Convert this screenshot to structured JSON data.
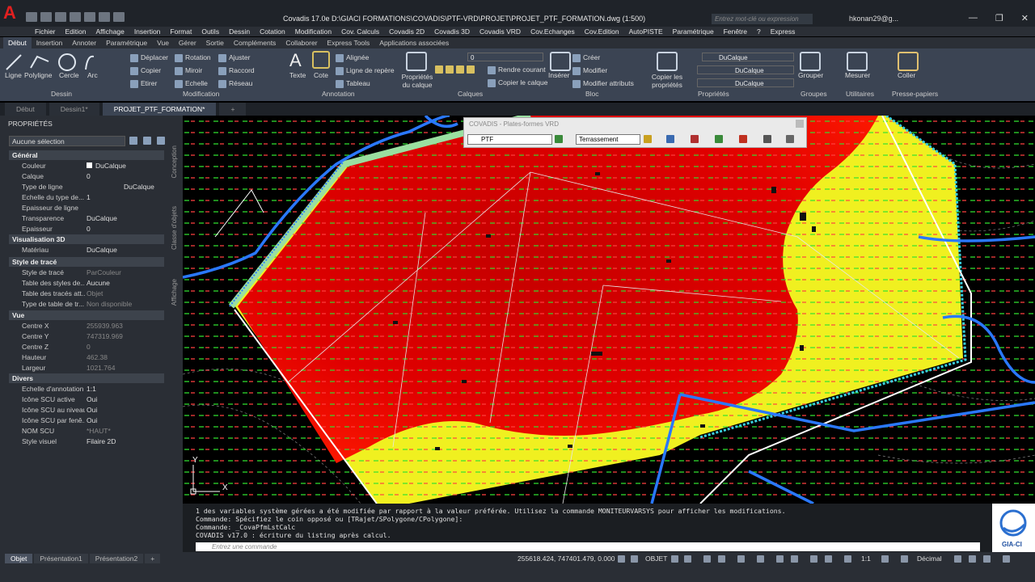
{
  "window": {
    "title": "Covadis 17.0e   D:\\GIACI FORMATIONS\\COVADIS\\PTF-VRD\\PROJET\\PROJET_PTF_FORMATION.dwg (1:500)",
    "search_placeholder": "Entrez mot-clé ou expression",
    "user": "hkonan29@g...",
    "controls": [
      "—",
      "❐",
      "✕"
    ]
  },
  "menu": [
    "Fichier",
    "Edition",
    "Affichage",
    "Insertion",
    "Format",
    "Outils",
    "Dessin",
    "Cotation",
    "Modification",
    "Cov. Calculs",
    "Covadis 2D",
    "Covadis 3D",
    "Covadis VRD",
    "Cov.Echanges",
    "Cov.Edition",
    "AutoPISTE",
    "Paramétrique",
    "Fenêtre",
    "?",
    "Express"
  ],
  "ribbon_tabs": [
    "Début",
    "Insertion",
    "Annoter",
    "Paramétrique",
    "Vue",
    "Gérer",
    "Sortie",
    "Compléments",
    "Collaborer",
    "Express Tools",
    "Applications associées"
  ],
  "ribbon": {
    "dessin": {
      "title": "Dessin",
      "tools": [
        "Ligne",
        "Polyligne",
        "Cercle",
        "Arc"
      ]
    },
    "modification": {
      "title": "Modification",
      "col1": [
        "Déplacer",
        "Copier",
        "Etirer"
      ],
      "col2": [
        "Rotation",
        "Miroir",
        "Echelle"
      ],
      "col3": [
        "Ajuster",
        "Raccord",
        "Réseau"
      ]
    },
    "annotation": {
      "title": "Annotation",
      "tools": [
        "Texte",
        "Cote"
      ],
      "list": [
        "Alignée",
        "Ligne de repère",
        "Tableau"
      ]
    },
    "calques": {
      "title": "Calques",
      "big": "Propriétés du calque",
      "layer": "0",
      "list": [
        "Rendre courant",
        "Copier le calque"
      ]
    },
    "bloc": {
      "title": "Bloc",
      "big": "Insérer",
      "list": [
        "Créer",
        "Modifier",
        "Modifier attributs"
      ]
    },
    "proprietes": {
      "title": "Propriétés",
      "big": "Copier les propriétés",
      "values": [
        "DuCalque",
        "DuCalque",
        "DuCalque"
      ]
    },
    "groupes": {
      "title": "Groupes",
      "big": "Grouper"
    },
    "utilitaires": {
      "title": "Utilitaires",
      "big": "Mesurer"
    },
    "presse": {
      "title": "Presse-papiers",
      "big": "Coller"
    }
  },
  "doc_tabs": [
    "Début",
    "Dessin1*",
    "PROJET_PTF_FORMATION*"
  ],
  "properties_panel": {
    "title": "PROPRIÉTÉS",
    "selection": "Aucune sélection",
    "side_tabs": [
      "Conception",
      "Classe d'objets",
      "Affichage"
    ],
    "sections": [
      {
        "name": "Général",
        "rows": [
          [
            "Couleur",
            "DuCalque"
          ],
          [
            "Calque",
            "0"
          ],
          [
            "Type de ligne",
            "DuCalque"
          ],
          [
            "Echelle du type de...",
            "1"
          ],
          [
            "Epaisseur de ligne",
            ""
          ],
          [
            "Transparence",
            "DuCalque"
          ],
          [
            "Epaisseur",
            "0"
          ]
        ]
      },
      {
        "name": "Visualisation 3D",
        "rows": [
          [
            "Matériau",
            "DuCalque"
          ]
        ]
      },
      {
        "name": "Style de tracé",
        "rows": [
          [
            "Style de tracé",
            "ParCouleur"
          ],
          [
            "Table des styles de...",
            "Aucune"
          ],
          [
            "Table des tracés att...",
            "Objet"
          ],
          [
            "Type de table de tr...",
            "Non disponible"
          ]
        ]
      },
      {
        "name": "Vue",
        "rows": [
          [
            "Centre X",
            "255939.963"
          ],
          [
            "Centre Y",
            "747319.969"
          ],
          [
            "Centre Z",
            "0"
          ],
          [
            "Hauteur",
            "462.38"
          ],
          [
            "Largeur",
            "1021.764"
          ]
        ]
      },
      {
        "name": "Divers",
        "rows": [
          [
            "Echelle d'annotation",
            "1:1"
          ],
          [
            "Icône SCU active",
            "Oui"
          ],
          [
            "Icône SCU au niveau...",
            "Oui"
          ],
          [
            "Icône SCU par fenê...",
            "Oui"
          ],
          [
            "NOM SCU",
            "*HAUT*"
          ],
          [
            "Style visuel",
            "Filaire 2D"
          ]
        ]
      }
    ]
  },
  "covadis_toolbar": {
    "title": "COVADIS - Plates-formes VRD",
    "platform": "PTF",
    "mode": "Terrassement"
  },
  "command_line": {
    "history": [
      "1 des variables système gérées a été modifiée par rapport à la valeur préférée. Utilisez la commande MONITEURVARSYS pour afficher les modifications.",
      "Commande: Spécifiez le coin opposé ou [TRajet/SPolygone/CPolygone]:",
      "Commande: _CovaPfmLstCalc",
      "COVADIS v17.0 : écriture du listing après calcul."
    ],
    "placeholder": "Entrez une commande"
  },
  "logo_text": "GIA-CI",
  "ucs": {
    "x": "X",
    "y": "Y"
  },
  "status": {
    "layout_tabs": [
      "Objet",
      "Présentation1",
      "Présentation2",
      "+"
    ],
    "coords": "255618.424, 747401.479, 0.000",
    "space": "OBJET",
    "scale": "1:1",
    "units": "Décimal"
  }
}
